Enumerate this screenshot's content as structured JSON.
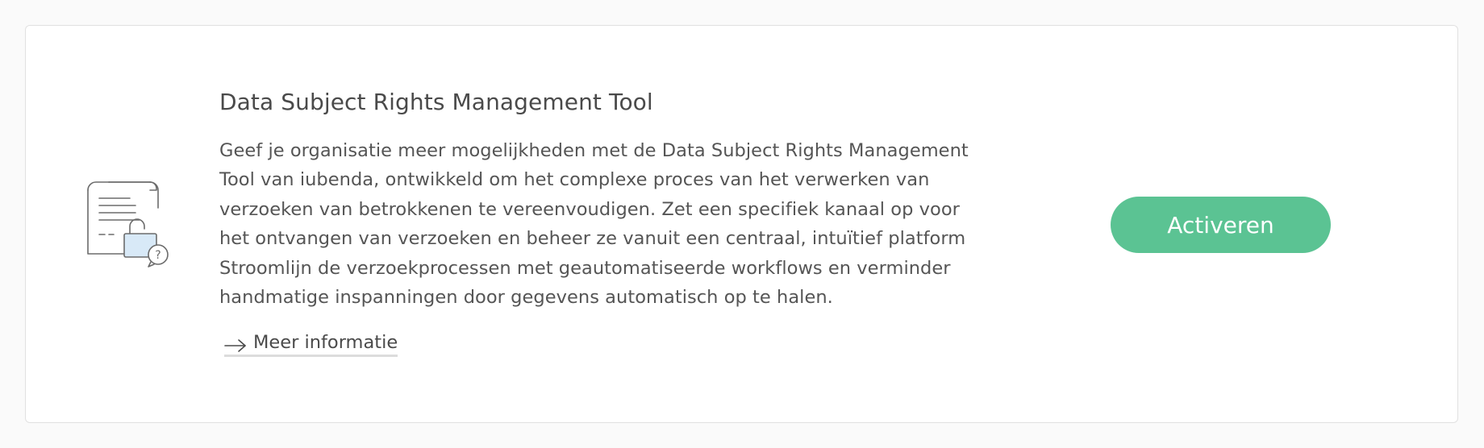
{
  "card": {
    "icon": "document-lock-question-icon",
    "title": "Data Subject Rights Management Tool",
    "description": "Geef je organisatie meer mogelijkheden met de Data Subject Rights Management Tool van iubenda, ontwikkeld om het complexe proces van het verwerken van verzoeken van betrokkenen te vereenvoudigen. Zet een specifiek kanaal op voor het ontvangen van verzoeken en beheer ze vanuit een centraal, intuïtief platform Stroomlijn de verzoekprocessen met geautomatiseerde workflows en verminder handmatige inspanningen door gegevens automatisch op te halen.",
    "more_link": {
      "icon": "arrow-right-icon",
      "label": "Meer informatie"
    },
    "activate_button": {
      "label": "Activeren",
      "color": "#5bc393"
    }
  }
}
